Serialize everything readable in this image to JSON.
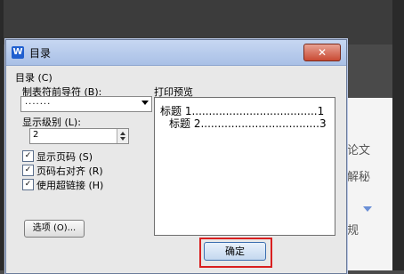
{
  "dialog": {
    "title": "目录",
    "app_icon": "W",
    "close_glyph": "✕"
  },
  "form": {
    "group_label": "目录 (C)",
    "tab_leader_label": "制表符前导符 (B):",
    "tab_leader_value": ".......",
    "levels_label": "显示级别 (L):",
    "levels_value": "2",
    "checkboxes": [
      {
        "label": "显示页码 (S)",
        "checked": true
      },
      {
        "label": "页码右对齐 (R)",
        "checked": true
      },
      {
        "label": "使用超链接 (H)",
        "checked": true
      }
    ],
    "options_button": "选项 (O)...",
    "ok_button": "确定"
  },
  "preview": {
    "label": "打印预览",
    "lines": [
      "标题 1.....................................1",
      "标题 2...................................3"
    ]
  },
  "background": {
    "frag1": "论文",
    "frag2": "解秘",
    "frag3": "规"
  },
  "colors": {
    "highlight": "#d91f1f",
    "titlebar": "#b8cdee",
    "close": "#c94a33"
  }
}
